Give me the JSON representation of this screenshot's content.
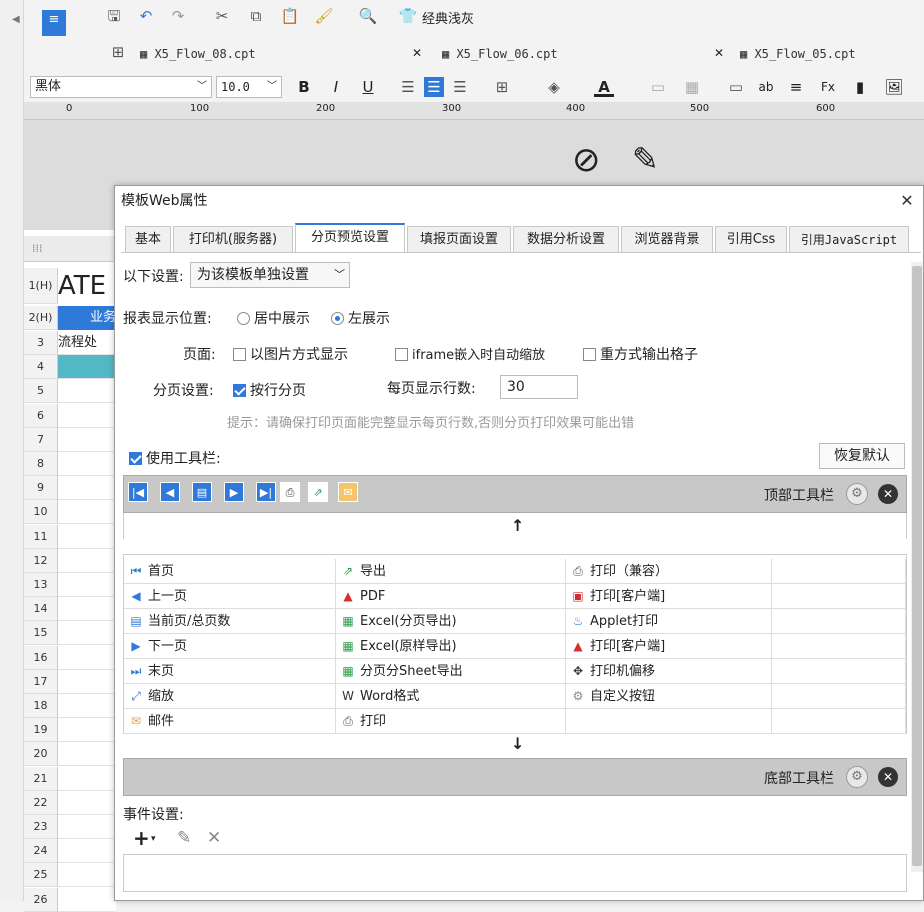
{
  "toolbar": {
    "theme_label": "经典浅灰",
    "font_name": "黑体",
    "font_size": "10.0"
  },
  "file_tabs": [
    {
      "name": "X5_Flow_08.cpt"
    },
    {
      "name": "X5_Flow_06.cpt"
    },
    {
      "name": "X5_Flow_05.cpt"
    }
  ],
  "ruler_ticks": [
    "0",
    "100",
    "200",
    "300",
    "400",
    "500",
    "600"
  ],
  "sheet": {
    "row_header_1": "1(H)",
    "row_header_2": "2(H)",
    "cell_title": "ATE (",
    "cell_header": "业务",
    "cell_flow": "流程处",
    "rows": [
      "3",
      "4",
      "5",
      "6",
      "7",
      "8",
      "9",
      "10",
      "11",
      "12",
      "13",
      "14",
      "15",
      "16",
      "17",
      "18",
      "19",
      "20",
      "21",
      "22",
      "23",
      "24",
      "25",
      "26"
    ]
  },
  "dialog": {
    "title": "模板Web属性",
    "tabs": [
      {
        "label": "基本"
      },
      {
        "label": "打印机(服务器)"
      },
      {
        "label": "分页预览设置"
      },
      {
        "label": "填报页面设置"
      },
      {
        "label": "数据分析设置"
      },
      {
        "label": "浏览器背景"
      },
      {
        "label": "引用Css"
      },
      {
        "label": "引用JavaScript"
      }
    ],
    "settings_label": "以下设置:",
    "settings_value": "为该模板单独设置",
    "position_label": "报表显示位置:",
    "position_center": "居中展示",
    "position_left": "左展示",
    "page_label": "页面:",
    "page_image": "以图片方式显示",
    "page_iframe": "iframe嵌入时自动缩放",
    "page_heavy": "重方式输出格子",
    "paging_label": "分页设置:",
    "paging_by_rows": "按行分页",
    "rows_per_page_label": "每页显示行数:",
    "rows_per_page_value": "30",
    "hint": "提示：请确保打印页面能完整显示每页行数,否则分页打印效果可能出错",
    "use_toolbar": "使用工具栏:",
    "restore_default": "恢复默认",
    "top_toolbar_label": "顶部工具栏",
    "bottom_toolbar_label": "底部工具栏",
    "event_label": "事件设置:"
  },
  "buttons_grid": {
    "col1": [
      "首页",
      "上一页",
      "当前页/总页数",
      "下一页",
      "末页",
      "缩放",
      "邮件"
    ],
    "col2": [
      "导出",
      "PDF",
      "Excel(分页导出)",
      "Excel(原样导出)",
      "分页分Sheet导出",
      "Word格式",
      "打印"
    ],
    "col3": [
      "打印（兼容）",
      "打印[客户端]",
      "Applet打印",
      "打印[客户端]",
      "打印机偏移",
      "自定义按钮",
      ""
    ]
  }
}
